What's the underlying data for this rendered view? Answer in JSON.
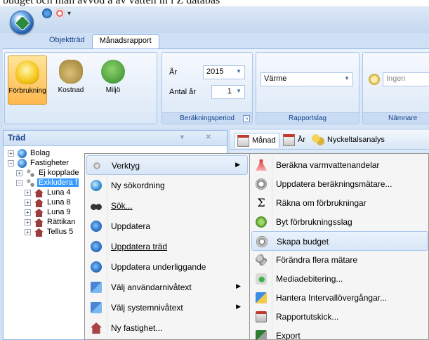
{
  "caption_fragment": "budget och man avvod a av vatten in i Z databas",
  "app": {
    "quick_access": [
      "orb-menu",
      "refresh",
      "help",
      "customize"
    ],
    "ribbon_tabs": [
      "Objektträd",
      "Månadsrapport"
    ],
    "active_tab": "Månadsrapport"
  },
  "ribbon": {
    "groups": [
      {
        "buttons": [
          {
            "label": "Förbrukning",
            "icon": "lightbulb-icon",
            "pressed": true
          },
          {
            "label": "Kostnad",
            "icon": "moneybag-icon",
            "pressed": false
          },
          {
            "label": "Miljö",
            "icon": "tree-icon",
            "pressed": false
          }
        ]
      },
      {
        "label": "Beräkningsperiod",
        "fields": [
          {
            "label": "År",
            "value": "2015"
          },
          {
            "label": "Antal år",
            "value": "1"
          }
        ]
      },
      {
        "label": "Rapportslag",
        "combo_value": "Värme"
      },
      {
        "label": "Nämnare",
        "combo_value": "Ingen"
      }
    ]
  },
  "tree": {
    "title": "Träd",
    "nodes": [
      {
        "label": "Bolag",
        "depth": 0,
        "expander": "+",
        "icon": "globe-icon"
      },
      {
        "label": "Fastigheter",
        "depth": 0,
        "expander": "−",
        "icon": "globe-icon"
      },
      {
        "label": "Ej kopplade",
        "depth": 1,
        "expander": "+",
        "icon": "pins-icon"
      },
      {
        "label": "Exkludera f",
        "depth": 1,
        "expander": "−",
        "icon": "pins-icon",
        "selected": true
      },
      {
        "label": "Luna 4",
        "depth": 2,
        "expander": "+",
        "icon": "house-icon"
      },
      {
        "label": "Luna 8",
        "depth": 2,
        "expander": "+",
        "icon": "house-icon"
      },
      {
        "label": "Luna 9",
        "depth": 2,
        "expander": "+",
        "icon": "house-icon"
      },
      {
        "label": "Rättikan",
        "depth": 2,
        "expander": "+",
        "icon": "house-icon"
      },
      {
        "label": "Tellus 5",
        "depth": 2,
        "expander": "+",
        "icon": "house-icon"
      }
    ]
  },
  "right_tabs": [
    "Månad",
    "År",
    "Nyckeltalsanalys"
  ],
  "context_menu": {
    "items": [
      {
        "label": "Verktyg",
        "icon": "tools-icon",
        "submenu": true,
        "highlighted": true
      },
      {
        "label": "Ny sökordning",
        "icon": "globe-icon"
      },
      {
        "label": "Sök...",
        "icon": "binoculars-icon",
        "underline": "S"
      },
      {
        "label": "Uppdatera",
        "icon": "refresh-icon"
      },
      {
        "label": "Uppdatera träd",
        "icon": "refresh-icon",
        "underline": "U"
      },
      {
        "label": "Uppdatera underliggande",
        "icon": "refresh-icon"
      },
      {
        "label": "Välj användarnivåtext",
        "icon": "language-icon",
        "submenu": true
      },
      {
        "label": "Välj systemnivåtext",
        "icon": "language-icon",
        "submenu": true
      },
      {
        "label": "Ny fastighet...",
        "icon": "house-icon"
      }
    ]
  },
  "submenu": {
    "items": [
      {
        "label": "Beräkna varmvattenandelar",
        "icon": "flask-icon"
      },
      {
        "label": "Uppdatera beräkningsmätare...",
        "icon": "meter-icon"
      },
      {
        "label": "Räkna om förbrukningar",
        "icon": "sigma-icon"
      },
      {
        "label": "Byt förbrukningsslag",
        "icon": "swap-icon"
      },
      {
        "label": "Skapa budget",
        "icon": "budget-icon",
        "highlighted": true
      },
      {
        "label": "Förändra flera mätare",
        "icon": "gears-icon"
      },
      {
        "label": "Mediadebitering...",
        "icon": "media-icon"
      },
      {
        "label": "Hantera Intervallövergångar...",
        "icon": "interval-icon"
      },
      {
        "label": "Rapportutskick...",
        "icon": "report-icon"
      },
      {
        "label": "Export",
        "icon": "export-icon"
      }
    ]
  }
}
